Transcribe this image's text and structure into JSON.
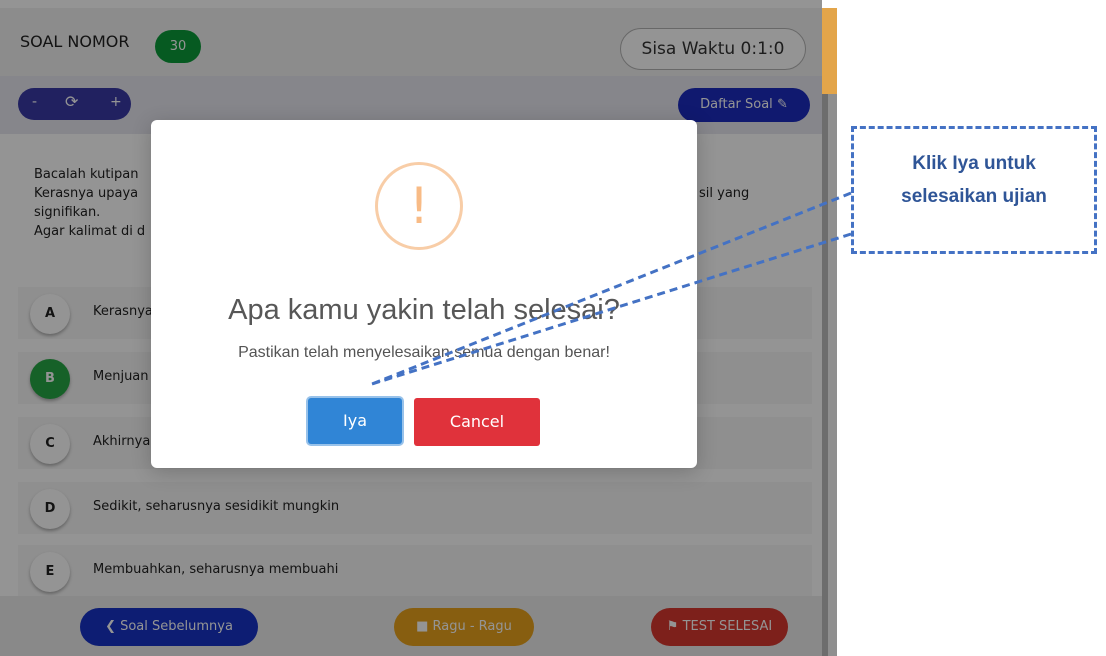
{
  "header": {
    "title": "SOAL NOMOR",
    "number": "30",
    "timer": "Sisa Waktu 0:1:0"
  },
  "toolbar": {
    "zoom_out": "-",
    "refresh_icon": "refresh-icon",
    "zoom_in": "+",
    "daftar_soal": "Daftar Soal"
  },
  "question": {
    "line1": "Bacalah kutipan",
    "line2a": "Kerasnya upaya",
    "line2b": "sil yang",
    "line3": "signifikan.",
    "line4": "Agar kalimat di d"
  },
  "options": [
    {
      "letter": "A",
      "text": "Kerasnya",
      "selected": false
    },
    {
      "letter": "B",
      "text": "Menjuan",
      "selected": true
    },
    {
      "letter": "C",
      "text": "Akhirnya",
      "selected": false
    },
    {
      "letter": "D",
      "text": "Sedikit, seharusnya sesidikit mungkin",
      "selected": false
    },
    {
      "letter": "E",
      "text": "Membuahkan, seharusnya membuahi",
      "selected": false
    }
  ],
  "footer": {
    "prev": "Soal Sebelumnya",
    "ragu": "Ragu - Ragu",
    "selesai": "TEST SELESAI"
  },
  "modal": {
    "icon": "!",
    "title": "Apa kamu yakin telah selesai?",
    "text": "Pastikan telah menyelesaikan semua dengan benar!",
    "confirm": "Iya",
    "cancel": "Cancel"
  },
  "annotation": {
    "line1": "Klik Iya untuk",
    "line2": "selesaikan ujian"
  },
  "colors": {
    "accent": "#3085d6",
    "cancel": "#e0323b",
    "annotation": "#4472c4"
  }
}
